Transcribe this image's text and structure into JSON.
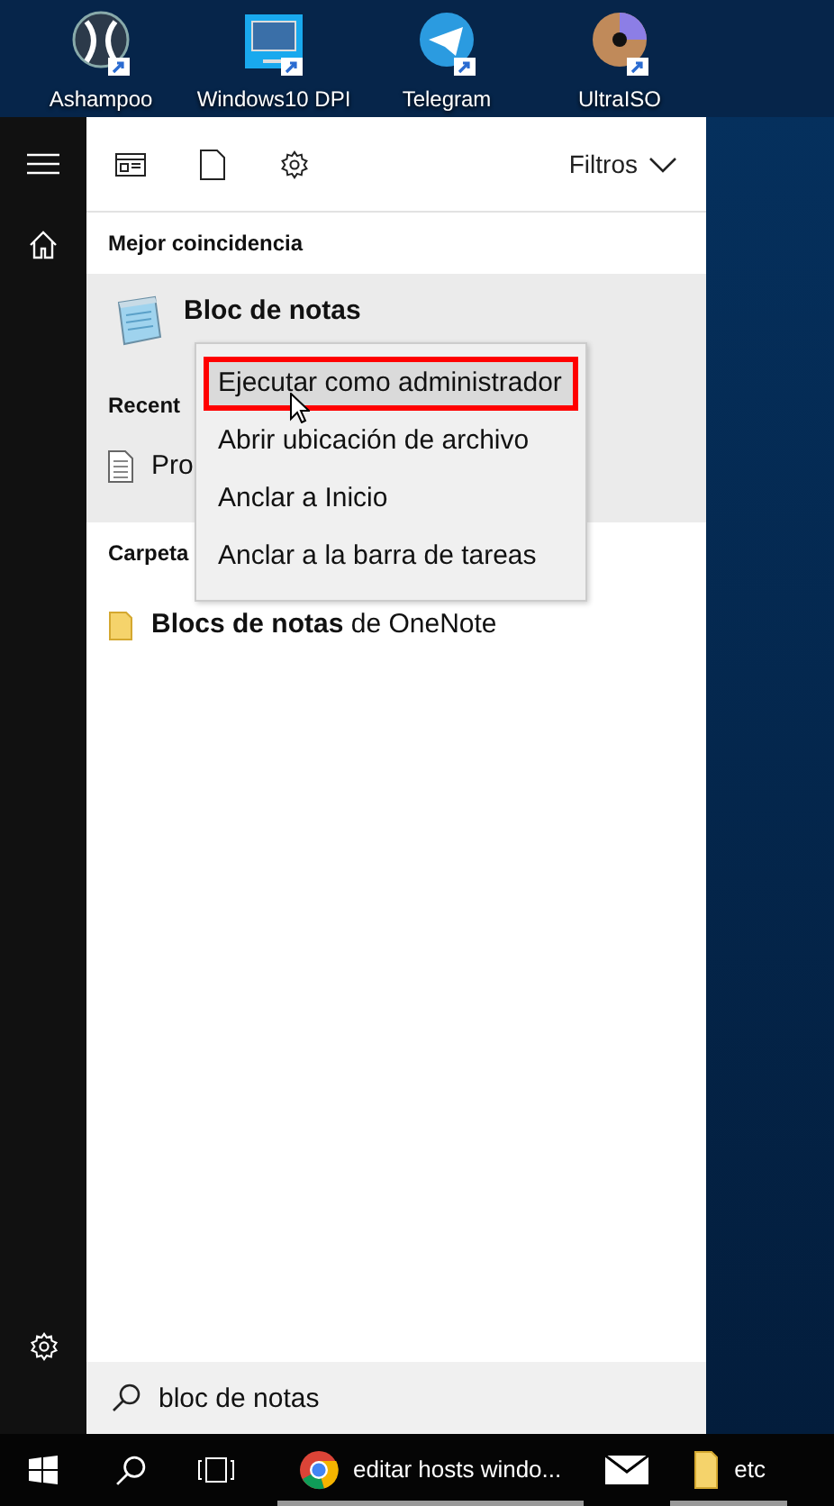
{
  "desktop_icons": [
    {
      "kind": "ashampoo",
      "label": "Ashampoo"
    },
    {
      "kind": "monitor",
      "label": "Windows10 DPI"
    },
    {
      "kind": "telegram",
      "label": "Telegram"
    },
    {
      "kind": "disc",
      "label": "UltraISO"
    }
  ],
  "toolbar": {
    "filter_label": "Filtros"
  },
  "best_match": {
    "heading": "Mejor coincidencia",
    "title": "Bloc de notas"
  },
  "recent": {
    "heading": "Recent",
    "items": [
      {
        "label": "Pro"
      }
    ]
  },
  "folders": {
    "heading": "Carpeta",
    "items": [
      {
        "label": "**Blocs de notas** de OneNote"
      }
    ]
  },
  "search": {
    "value": "bloc de notas"
  },
  "context_menu": {
    "items": [
      {
        "label": "Ejecutar como administrador",
        "selected": true
      },
      {
        "label": "Abrir ubicación de archivo",
        "selected": false
      },
      {
        "label": "Anclar a Inicio",
        "selected": false
      },
      {
        "label": "Anclar a la barra de tareas",
        "selected": false
      }
    ]
  },
  "taskbar": {
    "items": [
      {
        "kind": "chrome",
        "label": "editar hosts windo...",
        "running": true
      },
      {
        "kind": "mail",
        "running": false
      },
      {
        "kind": "folder",
        "label": "etc",
        "running": true
      }
    ]
  }
}
